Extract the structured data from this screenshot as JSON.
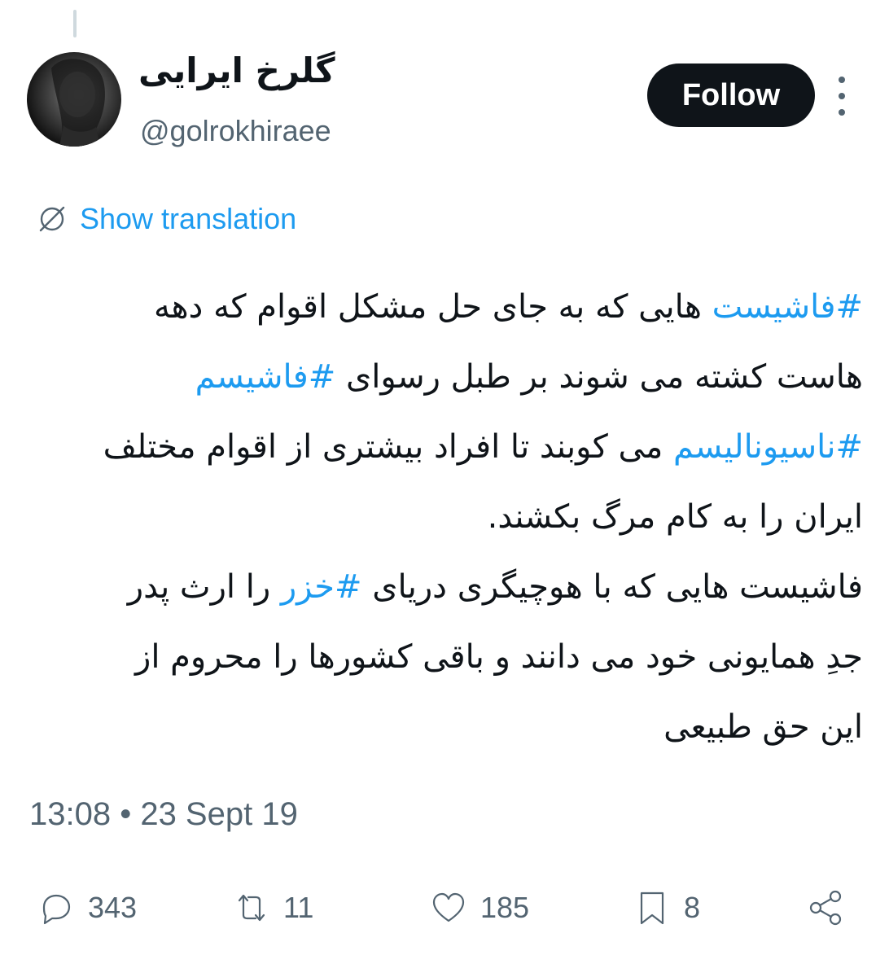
{
  "author": {
    "display_name": "گلرخ ایرایی",
    "handle": "@golrokhiraee"
  },
  "header": {
    "follow_label": "Follow",
    "more_icon": "more-vertical-icon"
  },
  "translation": {
    "label": "Show translation",
    "icon": "translate-globe-icon"
  },
  "tweet": {
    "lines": [
      [
        {
          "text": "#فاشیست",
          "hashtag": true
        },
        {
          "text": " هایی که به جای حل مشکل اقوام که دهه",
          "hashtag": false
        }
      ],
      [
        {
          "text": "هاست کشته می شوند بر طبل رسوای ",
          "hashtag": false
        },
        {
          "text": "#فاشیسم",
          "hashtag": true
        }
      ],
      [
        {
          "text": "#ناسیونالیسم",
          "hashtag": true
        },
        {
          "text": " می کوبند تا افراد بیشتری از اقوام مختلف",
          "hashtag": false
        }
      ],
      [
        {
          "text": "ایران را به کام مرگ بکشند.",
          "hashtag": false
        }
      ],
      [
        {
          "text": "فاشیست هایی که با هوچیگری دریای ",
          "hashtag": false
        },
        {
          "text": "#خزر",
          "hashtag": true
        },
        {
          "text": " را ارث پدر",
          "hashtag": false
        }
      ],
      [
        {
          "text": "جدِ همایونی خود می دانند و باقی کشورها را محروم از",
          "hashtag": false
        }
      ],
      [
        {
          "text": "این حق طبیعی",
          "hashtag": false
        }
      ]
    ],
    "timestamp": "13:08 • 23 Sept 19"
  },
  "actions": {
    "replies": "343",
    "retweets": "11",
    "likes": "185",
    "bookmarks": "8"
  },
  "colors": {
    "accent": "#1d9bf0",
    "text": "#0f1419",
    "muted": "#536471",
    "follow_bg": "#0f1419"
  }
}
